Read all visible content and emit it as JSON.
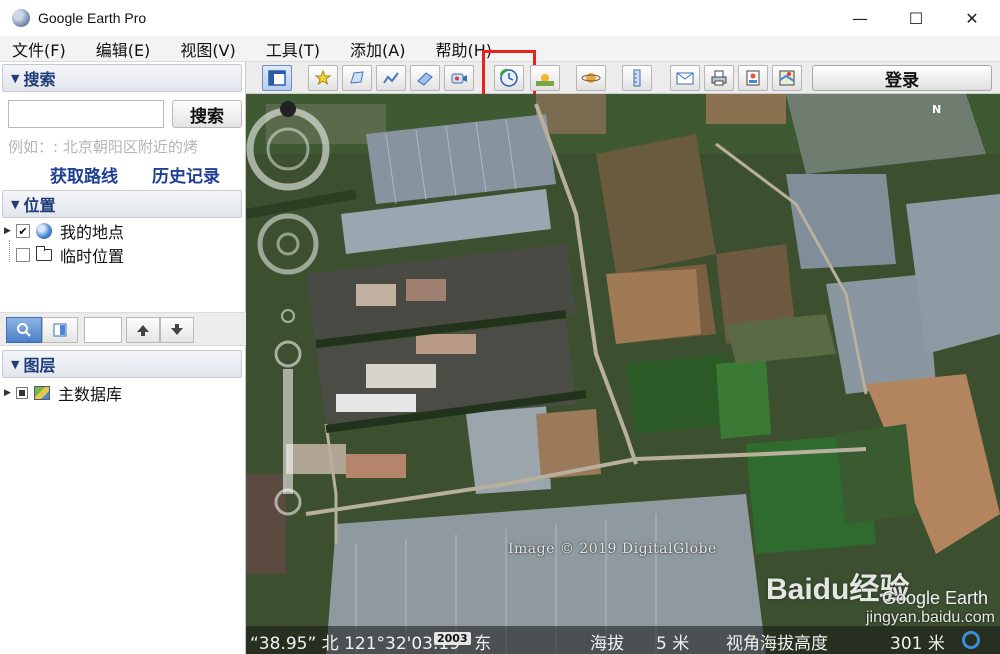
{
  "window": {
    "title": "Google Earth Pro"
  },
  "window_controls": {
    "minimize": "—",
    "maximize": "☐",
    "close": "✕"
  },
  "menu": [
    "文件(F)",
    "编辑(E)",
    "视图(V)",
    "工具(T)",
    "添加(A)",
    "帮助(H)"
  ],
  "search": {
    "header": "搜索",
    "input_value": "",
    "button": "搜索",
    "hint": "例如：: 北京朝阳区附近的烤",
    "get_directions": "获取路线",
    "history": "历史记录"
  },
  "places": {
    "header": "位置",
    "items": [
      {
        "label": "我的地点",
        "checked": true,
        "icon": "globe-icon"
      },
      {
        "label": "临时位置",
        "checked": false,
        "icon": "folder-icon"
      }
    ]
  },
  "layers": {
    "header": "图层",
    "items": [
      {
        "label": "主数据库",
        "icon": "layers-icon"
      }
    ]
  },
  "toolbar": {
    "buttons": [
      "sidebar-toggle-icon",
      "add-placemark-icon",
      "add-polygon-icon",
      "add-path-icon",
      "add-image-overlay-icon",
      "record-tour-icon",
      "historical-imagery-icon",
      "sunlight-icon",
      "planets-icon",
      "ruler-icon",
      "email-icon",
      "print-icon",
      "save-image-icon",
      "view-in-maps-icon"
    ],
    "login": "登录"
  },
  "map": {
    "copyright": "Image © 2019 DigitalGlobe",
    "logo": "Google Earth",
    "watermark": "Baidu经验",
    "watermark_url": "jingyan.baidu.com",
    "compass_n": "N"
  },
  "status": {
    "coords": "“38.95” 北 121°32'03.19” 东",
    "year": "2003",
    "elev_label": "海拔",
    "elev_value": "5 米",
    "eye_label": "视角海拔高度",
    "eye_value": "301 米"
  },
  "colors": {
    "accent": "#1f3c7a",
    "highlight": "#e8231f"
  }
}
